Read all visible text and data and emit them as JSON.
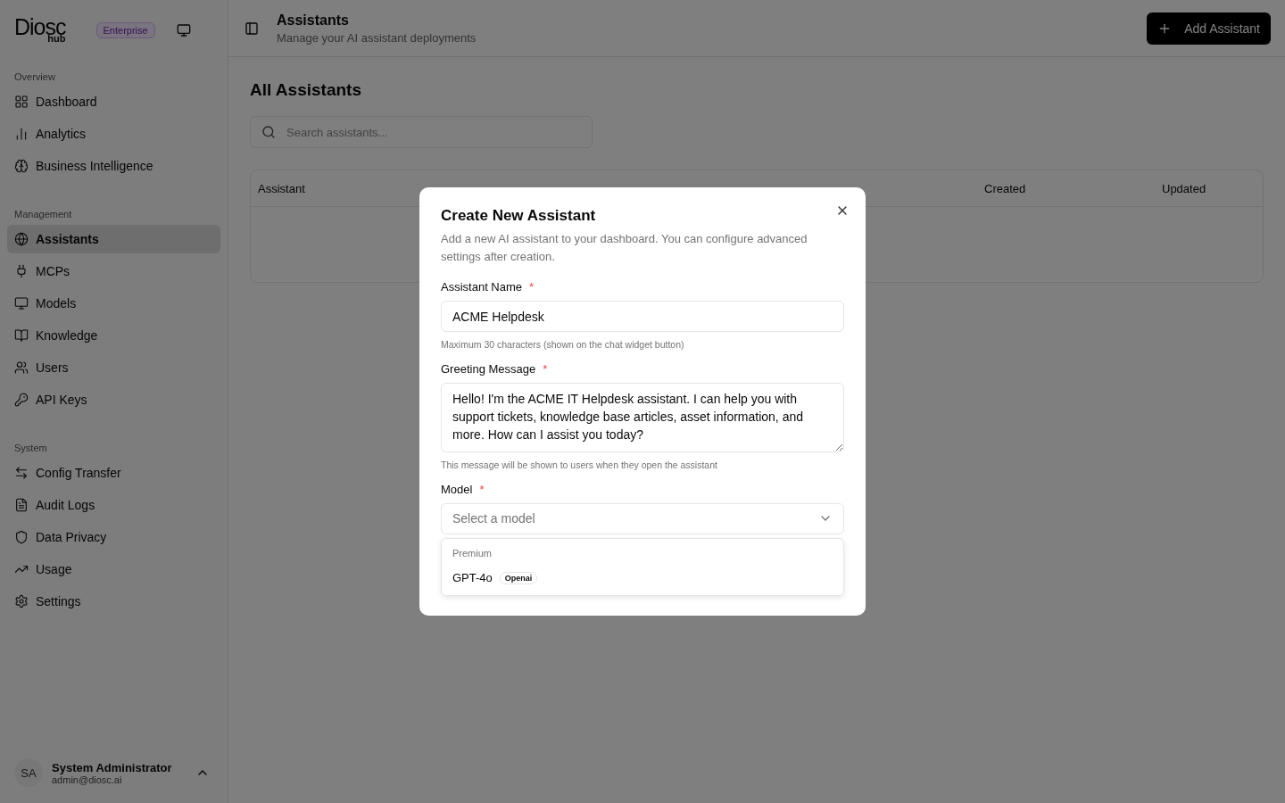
{
  "brand": {
    "logo": "Diosc",
    "logo_sub": "hub",
    "plan_badge": "Enterprise"
  },
  "sidebar": {
    "sections": [
      {
        "title": "Overview",
        "items": [
          {
            "label": "Dashboard",
            "selected": false
          },
          {
            "label": "Analytics",
            "selected": false
          },
          {
            "label": "Business Intelligence",
            "selected": false
          }
        ]
      },
      {
        "title": "Management",
        "items": [
          {
            "label": "Assistants",
            "selected": true
          },
          {
            "label": "MCPs",
            "selected": false
          },
          {
            "label": "Models",
            "selected": false
          },
          {
            "label": "Knowledge",
            "selected": false
          },
          {
            "label": "Users",
            "selected": false
          },
          {
            "label": "API Keys",
            "selected": false
          }
        ]
      },
      {
        "title": "System",
        "items": [
          {
            "label": "Config Transfer",
            "selected": false
          },
          {
            "label": "Audit Logs",
            "selected": false
          },
          {
            "label": "Data Privacy",
            "selected": false
          },
          {
            "label": "Usage",
            "selected": false
          },
          {
            "label": "Settings",
            "selected": false
          }
        ]
      }
    ],
    "user": {
      "initials": "SA",
      "name": "System Administrator",
      "email": "admin@diosc.ai"
    }
  },
  "header": {
    "title": "Assistants",
    "subtitle": "Manage your AI assistant deployments",
    "action": "Add Assistant"
  },
  "content": {
    "title": "All Assistants",
    "search": {
      "placeholder": "Search assistants..."
    },
    "table": {
      "columns": [
        {
          "label": "Assistant"
        },
        {
          "label": "Created"
        },
        {
          "label": "Updated"
        }
      ]
    }
  },
  "dialog": {
    "title": "Create New Assistant",
    "description": "Add a new AI assistant to your dashboard. You can configure advanced settings after creation.",
    "fields": [
      {
        "kind": "input",
        "label": "Assistant Name",
        "required_mark": "*",
        "value": "ACME Helpdesk",
        "hint": "Maximum 30 characters (shown on the chat widget button)"
      },
      {
        "kind": "textarea",
        "label": "Greeting Message",
        "required_mark": "*",
        "value": "Hello! I'm the ACME IT Helpdesk assistant. I can help you with support tickets, knowledge base articles, asset information, and more. How can I assist you today?",
        "hint": "This message will be shown to users when they open the assistant"
      },
      {
        "kind": "select",
        "label": "Model",
        "required_mark": "*",
        "placeholder": "Select a model",
        "expanded": true,
        "options": [
          {
            "group": "Premium",
            "items": [
              {
                "label": "GPT-4o",
                "tag": "Openai"
              }
            ]
          }
        ]
      }
    ]
  }
}
